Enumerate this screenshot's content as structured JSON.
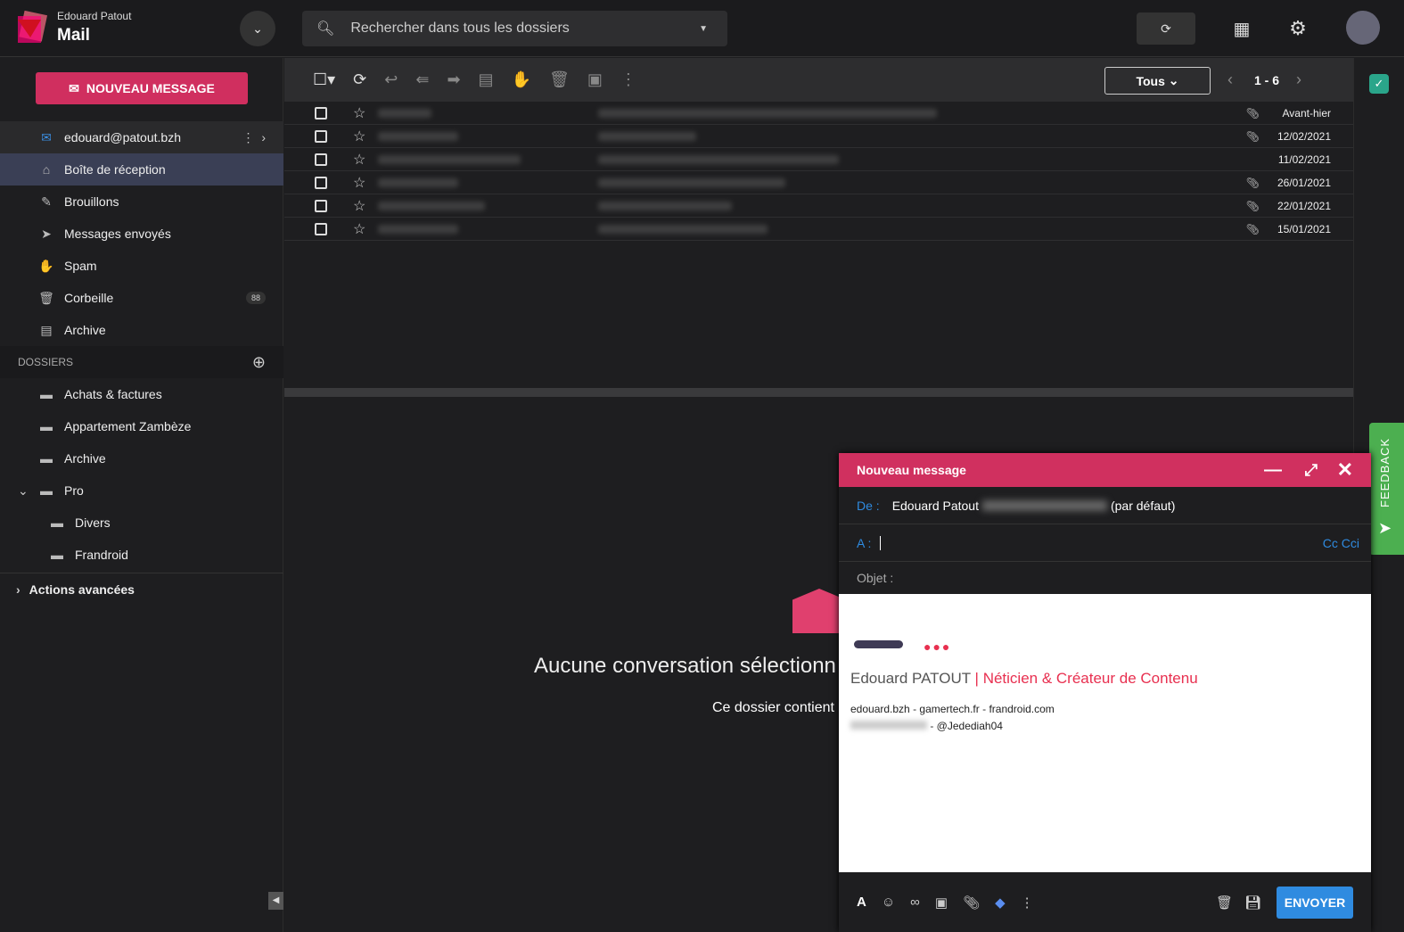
{
  "header": {
    "user_name": "Edouard Patout",
    "app_name": "Mail",
    "search_placeholder": "Rechercher dans tous les dossiers"
  },
  "sidebar": {
    "new_message": "NOUVEAU MESSAGE",
    "account": "edouard@patout.bzh",
    "folders": [
      {
        "label": "Boîte de réception",
        "icon": "inbox-icon"
      },
      {
        "label": "Brouillons",
        "icon": "draft-icon"
      },
      {
        "label": "Messages envoyés",
        "icon": "send-icon"
      },
      {
        "label": "Spam",
        "icon": "spam-icon"
      },
      {
        "label": "Corbeille",
        "icon": "trash-icon",
        "count": "88"
      },
      {
        "label": "Archive",
        "icon": "archive-icon"
      }
    ],
    "dossiers_title": "DOSSIERS",
    "dossiers": [
      {
        "label": "Achats & factures"
      },
      {
        "label": "Appartement Zambèze"
      },
      {
        "label": "Archive"
      },
      {
        "label": "Pro"
      },
      {
        "label": "Divers"
      },
      {
        "label": "Frandroid"
      }
    ],
    "advanced": "Actions avancées"
  },
  "toolbar": {
    "filter": "Tous",
    "pagination": "1 - 6"
  },
  "messages": [
    {
      "date": "Avant-hier",
      "attachment": true
    },
    {
      "date": "12/02/2021",
      "attachment": true
    },
    {
      "date": "11/02/2021",
      "attachment": false
    },
    {
      "date": "26/01/2021",
      "attachment": true
    },
    {
      "date": "22/01/2021",
      "attachment": true
    },
    {
      "date": "15/01/2021",
      "attachment": true
    }
  ],
  "reading": {
    "empty_title": "Aucune conversation sélectionn",
    "empty_sub": "Ce dossier contient"
  },
  "compose": {
    "title": "Nouveau message",
    "from_label": "De :",
    "from_name": "Edouard Patout",
    "from_suffix": "(par défaut)",
    "to_label": "A :",
    "cc": "Cc Cci",
    "subject_label": "Objet :",
    "sig_name": "Edouard PATOUT",
    "sig_sep": "|",
    "sig_role": "Néticien & Créateur de Contenu",
    "links": [
      "edouard.bzh",
      "gamertech.fr",
      "frandroid.com"
    ],
    "handle": "@Jedediah04",
    "send": "ENVOYER"
  },
  "feedback": "FEEDBACK",
  "colors": {
    "accent": "#d0305f",
    "link": "#2f8be0",
    "feedback": "#4caf50"
  }
}
